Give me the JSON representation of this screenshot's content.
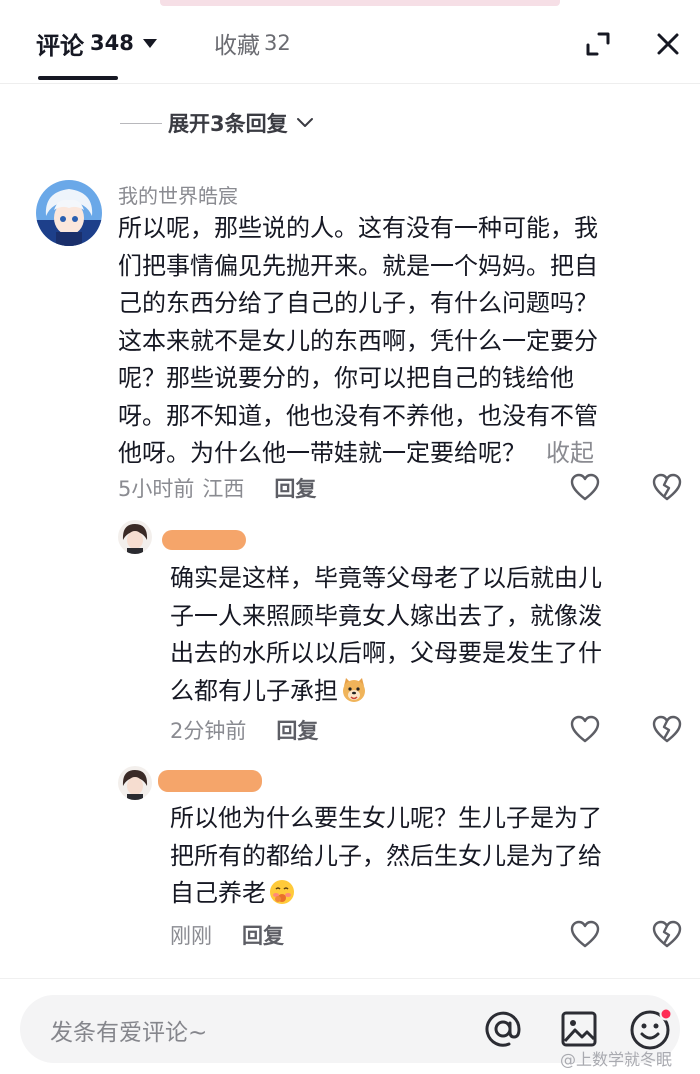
{
  "header": {
    "comments_label": "评论",
    "comments_count": "348",
    "favorites_label": "收藏",
    "favorites_count": "32"
  },
  "expand_replies": "展开3条回复",
  "main_comment": {
    "username": "我的世界皓宸",
    "text": "所以呢，那些说的人。这有没有一种可能，我们把事情偏见先抛开来。就是一个妈妈。把自己的东西分给了自己的儿子，有什么问题吗？这本来就不是女儿的东西啊，凭什么一定要分呢？那些说要分的，你可以把自己的钱给他呀。那不知道，他也没有不养他，也没有不管他呀。为什么他一带娃就一定要给呢？",
    "lines": [
      "所以呢，那些说的人。这有没有一种可能，我",
      "们把事情偏见先抛开来。就是一个妈妈。把自",
      "己的东西分给了自己的儿子，有什么问题吗？",
      "这本来就不是女儿的东西啊，凭什么一定要分",
      "呢？那些说要分的，你可以把自己的钱给他",
      "呀。那不知道，他也没有不养他，也没有不管",
      "他呀。为什么他一带娃就一定要给呢？"
    ],
    "collapse": "收起",
    "time": "5小时前",
    "location": "江西",
    "reply_label": "回复"
  },
  "replies": [
    {
      "lines": [
        "确实是这样，毕竟等父母老了以后就由儿",
        "子一人来照顾毕竟女人嫁出去了，就像泼",
        "出去的水所以以后啊，父母要是发生了什",
        "么都有儿子承担"
      ],
      "time": "2分钟前",
      "reply_label": "回复"
    },
    {
      "lines": [
        "所以他为什么要生女儿呢？生儿子是为了",
        "把所有的都给儿子，然后生女儿是为了给",
        "自己养老"
      ],
      "time": "刚刚",
      "reply_label": "回复"
    }
  ],
  "input": {
    "placeholder": "发条有爱评论~"
  },
  "watermark": "@上数学就冬眠",
  "icons": [
    "caret-down-icon",
    "expand-icon",
    "close-icon",
    "chevron-down-icon",
    "heart-icon",
    "broken-heart-icon",
    "at-icon",
    "image-icon",
    "emoji-face-icon"
  ],
  "colors": {
    "text": "#161823",
    "secondary": "#8a8b91",
    "redaction": "#f5a56a",
    "notification_dot": "#fe2c55"
  }
}
